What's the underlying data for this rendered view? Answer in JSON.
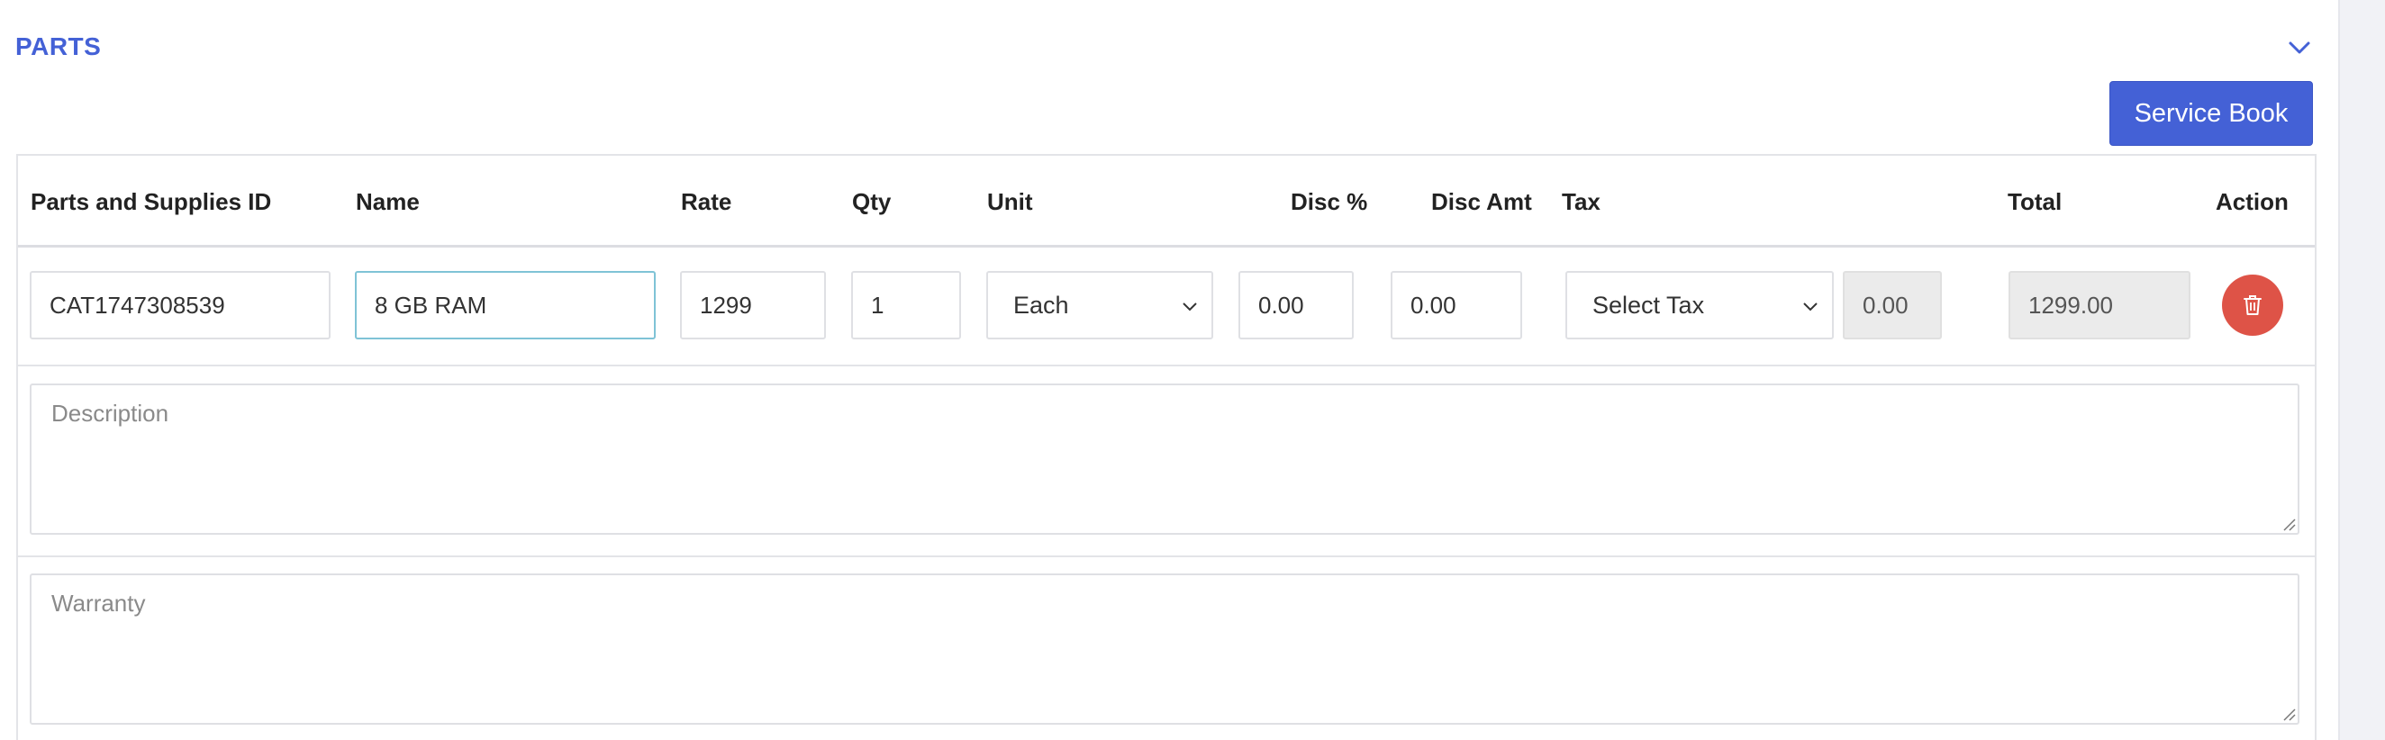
{
  "section": {
    "title": "PARTS",
    "collapse_icon": "chevron-down-icon"
  },
  "toolbar": {
    "service_book_label": "Service Book"
  },
  "table": {
    "headers": {
      "id": "Parts and Supplies ID",
      "name": "Name",
      "rate": "Rate",
      "qty": "Qty",
      "unit": "Unit",
      "disc_pct": "Disc %",
      "disc_amt": "Disc Amt",
      "tax": "Tax",
      "total": "Total",
      "action": "Action"
    },
    "row": {
      "id": "CAT1747308539",
      "name": "8 GB RAM",
      "rate": "1299",
      "qty": "1",
      "unit": "Each",
      "disc_pct": "0.00",
      "disc_amt": "0.00",
      "tax": "Select Tax",
      "tax_amount": "0.00",
      "total": "1299.00",
      "delete_icon": "trash-icon"
    },
    "description_placeholder": "Description",
    "warranty_placeholder": "Warranty"
  },
  "colors": {
    "accent": "#4461d6",
    "danger": "#de5347",
    "focus_border": "#7fc3d6"
  }
}
